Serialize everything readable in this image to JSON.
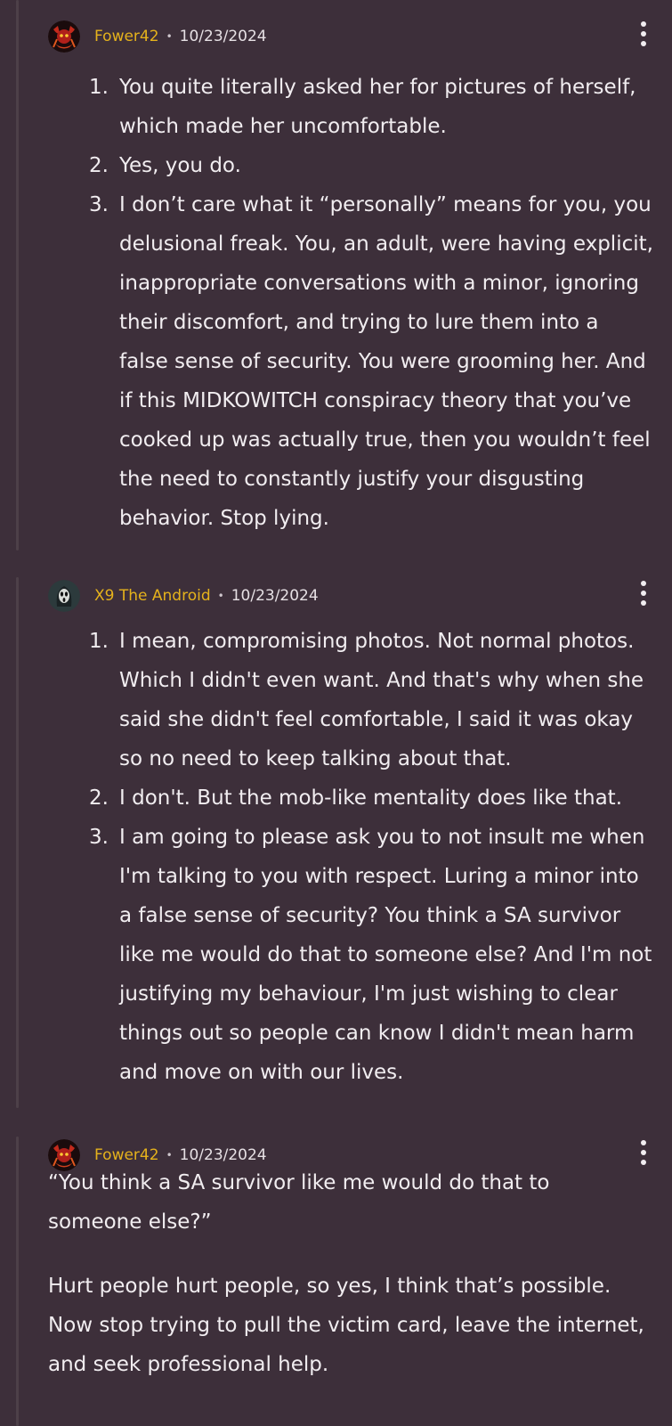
{
  "comments": [
    {
      "username": "Fower42",
      "separator": "•",
      "date": "10/23/2024",
      "items": [
        {
          "num": "1.",
          "text": "You quite literally asked her for pictures of herself, which made her uncomfortable."
        },
        {
          "num": "2.",
          "text": "Yes, you do."
        },
        {
          "num": "3.",
          "text": "I don’t care what it “personally” means for you, you delusional freak. You, an adult, were having explicit, inappropriate conversations with a minor, ignoring their discomfort, and trying to lure them into a false sense of security. You were grooming her. And if this MIDKOWITCH conspiracy theory that you’ve cooked up was actually true, then you wouldn’t feel the need to constantly justify your disgusting behavior. Stop lying."
        }
      ]
    },
    {
      "username": "X9 The Android",
      "separator": "•",
      "date": "10/23/2024",
      "items": [
        {
          "num": "1.",
          "text": "I mean, compromising photos. Not normal photos. Which I didn't even want. And that's why when she said she didn't feel comfortable, I said it was okay so no need to keep talking about that."
        },
        {
          "num": "2.",
          "text": "I don't. But the mob-like mentality does like that."
        },
        {
          "num": "3.",
          "text": "I am going to please ask you to not insult me when I'm talking to you with respect. Luring a minor into a false sense of security? You think a SA survivor like me would do that to someone else? And I'm not justifying my behaviour, I'm just wishing to clear things out so people can know I didn't mean harm and move on with our lives."
        }
      ]
    },
    {
      "username": "Fower42",
      "separator": "•",
      "date": "10/23/2024",
      "paragraphs": [
        "“You think a SA survivor like me would do that to someone else?”",
        "Hurt people hurt people, so yes, I think that’s possible. Now stop trying to pull the victim card, leave the internet, and seek professional help."
      ]
    }
  ],
  "icons": {
    "more": "vertical-ellipsis-icon",
    "avatar_fower": "demon-avatar-icon",
    "avatar_x9": "ghostface-avatar-icon"
  },
  "colors": {
    "background": "#3d2f3a",
    "username": "#e5b21c",
    "text": "#f1edf0",
    "thread_line": "#4d4048"
  }
}
